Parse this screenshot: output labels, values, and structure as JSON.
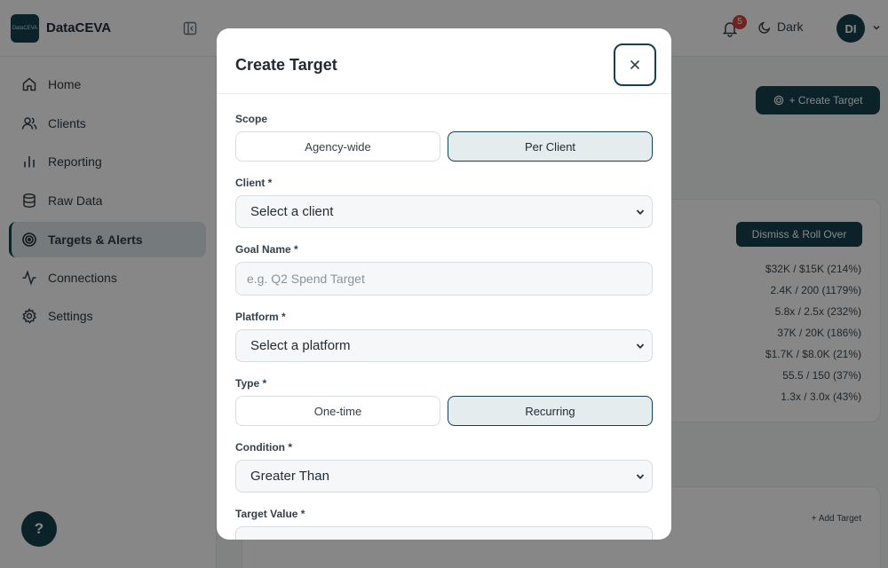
{
  "app": {
    "logo_text": "DataCEVA",
    "brand": "DataCEVA",
    "notification_count": "5",
    "theme_label": "Dark",
    "avatar_initials": "DI"
  },
  "sidebar": {
    "items": [
      {
        "label": "Home",
        "icon": "home-icon"
      },
      {
        "label": "Clients",
        "icon": "users-icon"
      },
      {
        "label": "Reporting",
        "icon": "bar-chart-icon"
      },
      {
        "label": "Raw Data",
        "icon": "database-icon"
      },
      {
        "label": "Targets & Alerts",
        "icon": "target-icon",
        "active": true
      },
      {
        "label": "Connections",
        "icon": "activity-icon"
      },
      {
        "label": "Settings",
        "icon": "gear-icon"
      }
    ],
    "help_label": "?"
  },
  "background": {
    "create_target_label": "+ Create Target",
    "dismiss_label": "Dismiss & Roll Over",
    "metrics": [
      "$32K / $15K (214%)",
      "2.4K / 200 (1179%)",
      "5.8x / 2.5x (232%)",
      "37K / 20K (186%)",
      "$1.7K / $8.0K (21%)",
      "55.5 / 150 (37%)",
      "1.3x / 3.0x (43%)"
    ],
    "add_target_label": "+ Add Target"
  },
  "modal": {
    "title": "Create Target",
    "scope": {
      "label": "Scope",
      "options": [
        "Agency-wide",
        "Per Client"
      ],
      "selected": "Per Client"
    },
    "client": {
      "label": "Client *",
      "value": "Select a client"
    },
    "goal_name": {
      "label": "Goal Name *",
      "placeholder": "e.g. Q2 Spend Target",
      "value": ""
    },
    "platform": {
      "label": "Platform *",
      "value": "Select a platform"
    },
    "type": {
      "label": "Type *",
      "options": [
        "One-time",
        "Recurring"
      ],
      "selected": "Recurring"
    },
    "condition": {
      "label": "Condition *",
      "value": "Greater Than"
    },
    "target_value": {
      "label": "Target Value *",
      "placeholder": "",
      "value": ""
    }
  },
  "colors": {
    "primary": "#16404f",
    "badge": "#d2463c",
    "selected_segment_bg": "#e4ecee"
  }
}
